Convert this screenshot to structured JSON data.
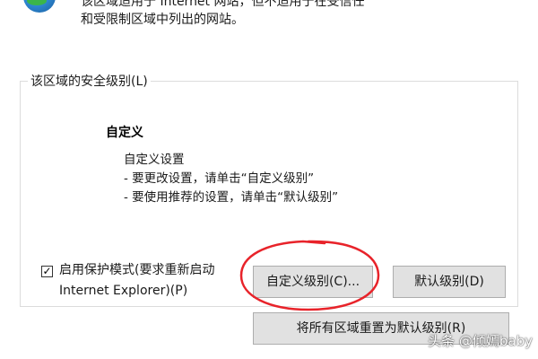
{
  "description": {
    "line1": "该区域适用于 Internet 网站，但不适用于在受信任",
    "line2": "和受限制区域中列出的网站。"
  },
  "security_level": {
    "group_label": "该区域的安全级别(L)",
    "level_name": "自定义",
    "detail_title": "自定义设置",
    "detail_line1": "- 要更改设置，请单击“自定义级别”",
    "detail_line2": "- 要使用推荐的设置，请单击“默认级别”"
  },
  "protected_mode": {
    "checked": true,
    "check_glyph": "✓",
    "label_line1": "启用保护模式(要求重新启动",
    "label_line2": "Internet Explorer)(P)"
  },
  "buttons": {
    "custom_level": "自定义级别(C)...",
    "default_level": "默认级别(D)",
    "reset_all": "将所有区域重置为默认级别(R)"
  },
  "annotation": {
    "highlight_color": "#e8232a"
  },
  "watermark": {
    "text": "头条 @倾嫣baby"
  }
}
